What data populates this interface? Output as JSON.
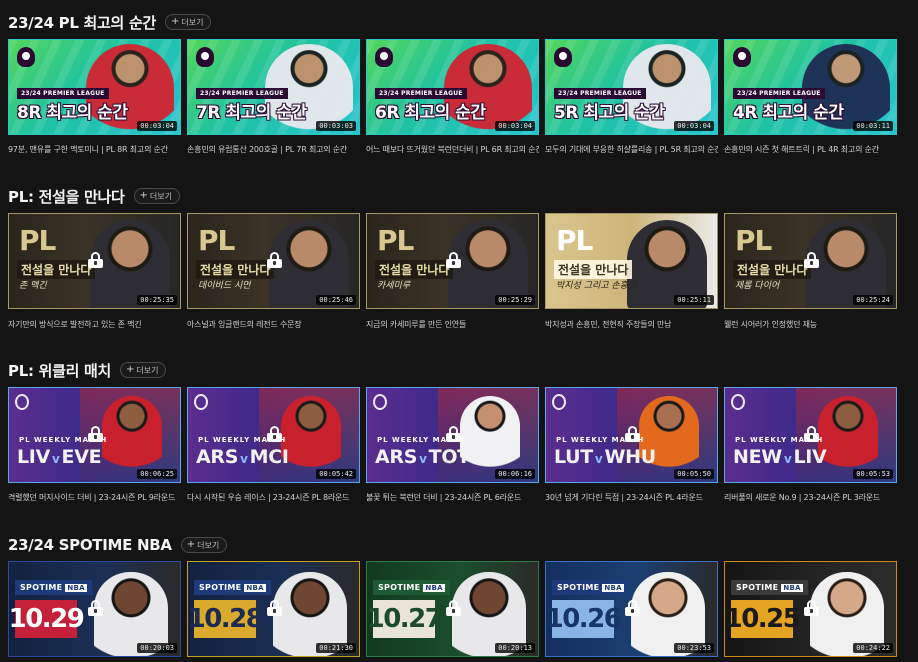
{
  "more_label": "더보기",
  "sections": [
    {
      "title": "23/24 PL 최고의 순간",
      "cards": [
        {
          "tag": "23/24 PREMIER LEAGUE",
          "title": "8R 최고의 순간",
          "duration": "00:03:04",
          "caption": "97분, 맨유를 구한 맥토미니 | PL 8R 최고의 순간"
        },
        {
          "tag": "23/24 PREMIER LEAGUE",
          "title": "7R 최고의 순간",
          "duration": "00:03:03",
          "caption": "손흥민의 유럽통산 200호골 | PL 7R 최고의 순간"
        },
        {
          "tag": "23/24 PREMIER LEAGUE",
          "title": "6R 최고의 순간",
          "duration": "00:03:04",
          "caption": "어느 때보다 뜨거웠던 북런던더비 | PL 6R 최고의 순간"
        },
        {
          "tag": "23/24 PREMIER LEAGUE",
          "title": "5R 최고의 순간",
          "duration": "00:03:04",
          "caption": "모두의 기대에 부응한 히샬를리송 | PL 5R 최고의 순간"
        },
        {
          "tag": "23/24 PREMIER LEAGUE",
          "title": "4R 최고의 순간",
          "duration": "00:03:11",
          "caption": "손흥민의 시즌 첫 해트트릭 | PL 4R 최고의 순간"
        }
      ]
    },
    {
      "title": "PL: 전설을 만나다",
      "cards": [
        {
          "logo": "PL",
          "band": "전설을 만나다",
          "sub": "존 맥긴",
          "duration": "00:25:35",
          "caption": "자기만의 방식으로 발전하고 있는 존 맥긴"
        },
        {
          "logo": "PL",
          "band": "전설을 만나다",
          "sub": "데이비드 시먼",
          "duration": "00:25:46",
          "caption": "아스널과 잉글랜드의 레전드 수문장"
        },
        {
          "logo": "PL",
          "band": "전설을 만나다",
          "sub": "카세미루",
          "duration": "00:25:29",
          "caption": "지금의 카세미루를 만든 인연들"
        },
        {
          "logo": "PL",
          "band": "전설을 만나다",
          "sub": "박지성 그리고 손흥민",
          "duration": "00:25:11",
          "caption": "박지성과 손흥민, 전현직 주장들의 만남"
        },
        {
          "logo": "PL",
          "band": "전설을 만나다",
          "sub": "제롬 다이어",
          "duration": "00:25:24",
          "caption": "웰런 시어러가 인정했던 재능"
        }
      ]
    },
    {
      "title": "PL: 위클리 매치",
      "cards": [
        {
          "tag": "PL WEEKLY MATCH",
          "home": "LIV",
          "away": "EVE",
          "duration": "00:06:25",
          "caption": "격렬했던 머지사이드 더비 | 23-24시즌 PL 9라운드"
        },
        {
          "tag": "PL WEEKLY MATCH",
          "home": "ARS",
          "away": "MCI",
          "duration": "00:05:42",
          "caption": "다시 시작된 우승 레이스 | 23-24시즌 PL 8라운드"
        },
        {
          "tag": "PL WEEKLY MATCH",
          "home": "ARS",
          "away": "TOT",
          "duration": "00:06:16",
          "caption": "불꽃 튀는 북런던 더비 | 23-24시즌 PL 6라운드"
        },
        {
          "tag": "PL WEEKLY MATCH",
          "home": "LUT",
          "away": "WHU",
          "duration": "00:05:50",
          "caption": "30년 넘게 기다린 득점 | 23-24시즌 PL 4라운드"
        },
        {
          "tag": "PL WEEKLY MATCH",
          "home": "NEW",
          "away": "LIV",
          "duration": "00:05:53",
          "caption": "리버풀의 새로운 No.9 | 23-24시즌 PL 3라운드"
        }
      ]
    },
    {
      "title": "23/24 SPOTIME NBA",
      "cards": [
        {
          "brand": "SPOTIME",
          "league": "NBA",
          "date": "10.29",
          "duration": "00:20:03"
        },
        {
          "brand": "SPOTIME",
          "league": "NBA",
          "date": "10.28",
          "duration": "00:21:30"
        },
        {
          "brand": "SPOTIME",
          "league": "NBA",
          "date": "10.27",
          "duration": "00:20:13"
        },
        {
          "brand": "SPOTIME",
          "league": "NBA",
          "date": "10.26",
          "duration": "00:23:53"
        },
        {
          "brand": "SPOTIME",
          "league": "NBA",
          "date": "10.25",
          "duration": "00:24:22"
        }
      ]
    }
  ],
  "colors": {
    "background": "#141414",
    "moment_border": "#2bc7c4",
    "legend_border": "#a89760",
    "weekly_border": "#5aa6e8",
    "nba_red": "#c5203a"
  },
  "icons": {
    "lock": "lock-icon",
    "plus": "plus-icon",
    "pl_logo": "premier-league-logo-icon"
  }
}
